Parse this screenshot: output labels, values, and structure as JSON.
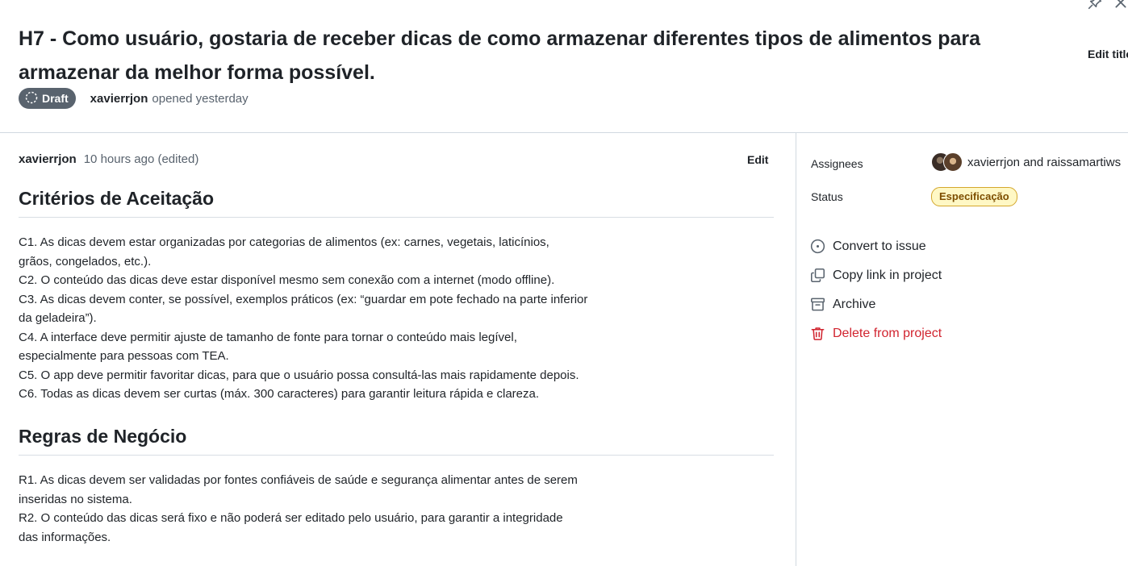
{
  "title": "H7 - Como usuário, gostaria de receber dicas de como armazenar diferentes tipos de alimentos para armazenar da melhor forma possível.",
  "header": {
    "edit_title_label": "Edit title",
    "draft_label": "Draft",
    "author": "xavierrjon",
    "opened_text": "opened yesterday",
    "icons": [
      "pin-icon",
      "close-icon",
      "draft-circle-icon"
    ]
  },
  "comment": {
    "author": "xavierrjon",
    "time": "10 hours ago (edited)",
    "edit_label": "Edit",
    "section1": {
      "heading": "Critérios de Aceitação",
      "lines": [
        "C1. As dicas devem estar organizadas por categorias de alimentos (ex: carnes, vegetais, laticínios,",
        "grãos, congelados, etc.).",
        "C2. O conteúdo das dicas deve estar disponível mesmo sem conexão com a internet (modo offline).",
        "C3. As dicas devem conter, se possível, exemplos práticos (ex: “guardar em pote fechado na parte inferior",
        "da geladeira”).",
        "C4. A interface deve permitir ajuste de tamanho de fonte para tornar o conteúdo mais legível,",
        "especialmente para pessoas com TEA.",
        "C5. O app deve permitir favoritar dicas, para que o usuário possa consultá-las mais rapidamente depois.",
        "C6. Todas as dicas devem ser curtas (máx. 300 caracteres) para garantir leitura rápida e clareza."
      ]
    },
    "section2": {
      "heading": "Regras de Negócio",
      "lines": [
        "R1. As dicas devem ser validadas por fontes confiáveis de saúde e segurança alimentar antes de serem",
        "inseridas no sistema.",
        "R2. O conteúdo das dicas será fixo e não poderá ser editado pelo usuário, para garantir a integridade",
        "das informações."
      ]
    }
  },
  "sidebar": {
    "assignees_label": "Assignees",
    "assignees_text": "xavierrjon and raissamartiws",
    "status_label": "Status",
    "status_value": "Especificação",
    "actions": {
      "convert": "Convert to issue",
      "copy_link": "Copy link in project",
      "archive": "Archive",
      "delete": "Delete from project"
    },
    "colors": {
      "status_bg": "#fff8c5",
      "status_border": "#d4a72c",
      "status_text": "#7d4e00",
      "danger": "#d1242f",
      "draft_bg": "#59636e"
    }
  }
}
